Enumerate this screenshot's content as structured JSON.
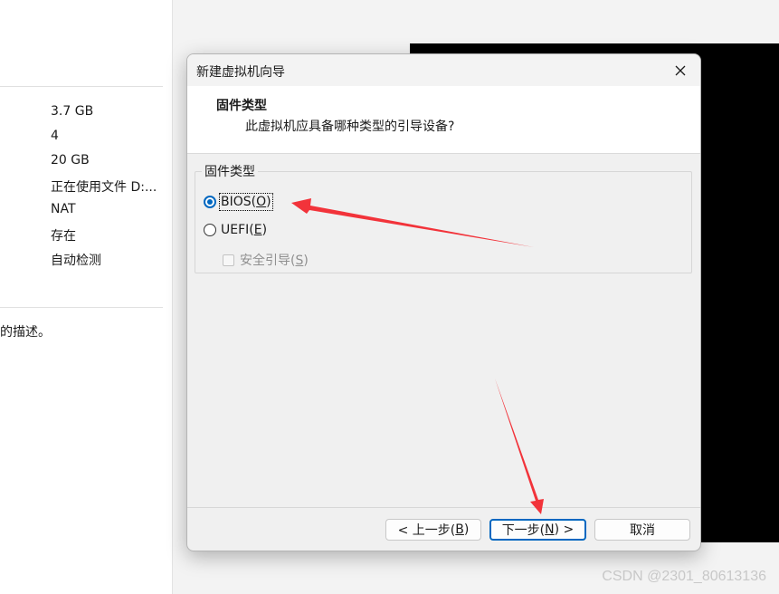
{
  "background": {
    "specs": [
      "3.7 GB",
      "4",
      "20 GB",
      "正在使用文件 D:...",
      "NAT",
      "存在",
      "自动检测"
    ],
    "description_fragment": "的描述。",
    "watermark": "CSDN @2301_80613136"
  },
  "dialog": {
    "title": "新建虚拟机向导",
    "header_title": "固件类型",
    "header_subtitle": "此虚拟机应具备哪种类型的引导设备?",
    "group_label": "固件类型",
    "options": [
      {
        "text": "BIOS(",
        "key": "O",
        "tail": ")",
        "checked": true
      },
      {
        "text": "UEFI(",
        "key": "E",
        "tail": ")",
        "checked": false
      }
    ],
    "secure_boot": {
      "text": "安全引导(",
      "key": "S",
      "tail": ")",
      "checked": false,
      "enabled": false
    },
    "buttons": {
      "back": {
        "pre": "< 上一步(",
        "key": "B",
        "post": ")"
      },
      "next": {
        "pre": "下一步(",
        "key": "N",
        "post": ") >"
      },
      "cancel": "取消"
    }
  },
  "colors": {
    "accent": "#0067c0",
    "annotation_arrow": "#f2333a"
  }
}
